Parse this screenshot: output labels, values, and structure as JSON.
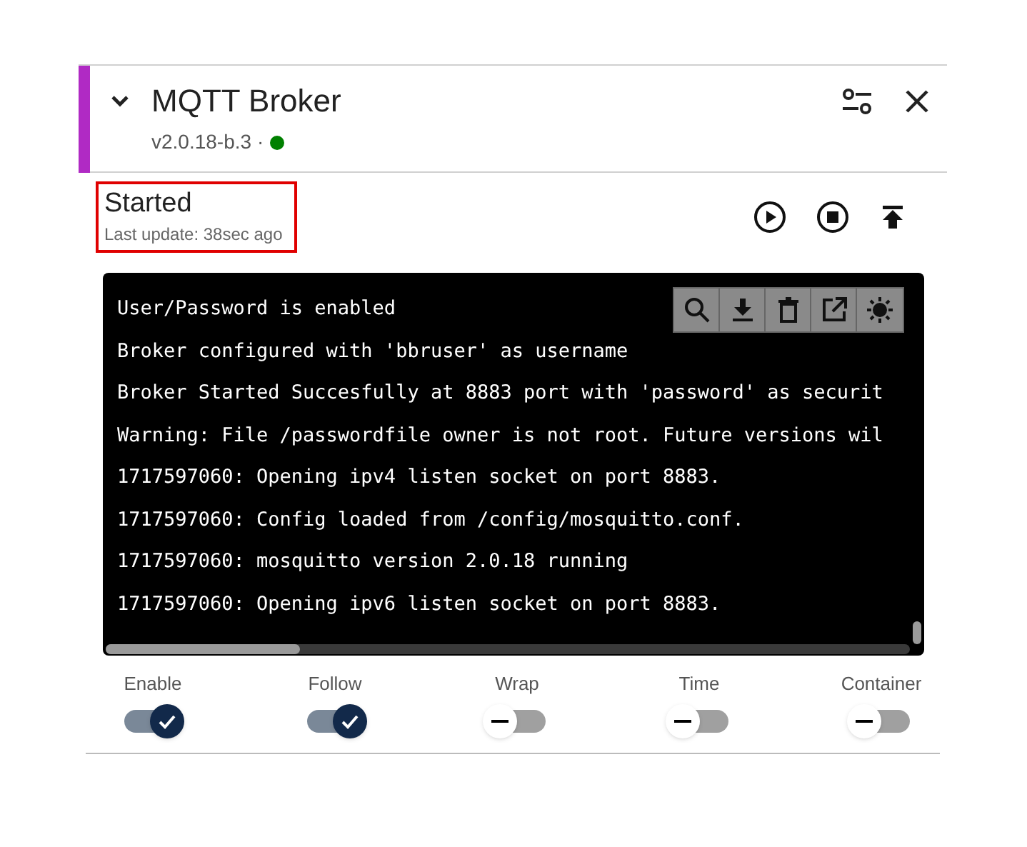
{
  "header": {
    "title": "MQTT Broker",
    "version": "v2.0.18-b.3 ·"
  },
  "status": {
    "state": "Started",
    "last_update": "Last update: 38sec ago",
    "highlighted": true
  },
  "log": {
    "lines": [
      "User/Password is enabled",
      "Broker configured with 'bbruser' as username",
      "Broker Started Succesfully at 8883 port with 'password' as securit",
      "Warning: File /passwordfile owner is not root. Future versions wil",
      "1717597060: Opening ipv4 listen socket on port 8883.",
      "1717597060: Config loaded from /config/mosquitto.conf.",
      "1717597060: mosquitto version 2.0.18 running",
      "1717597060: Opening ipv6 listen socket on port 8883."
    ]
  },
  "toggles": [
    {
      "label": "Enable",
      "on": true
    },
    {
      "label": "Follow",
      "on": true
    },
    {
      "label": "Wrap",
      "on": false
    },
    {
      "label": "Time",
      "on": false
    },
    {
      "label": "Container",
      "on": false
    }
  ]
}
